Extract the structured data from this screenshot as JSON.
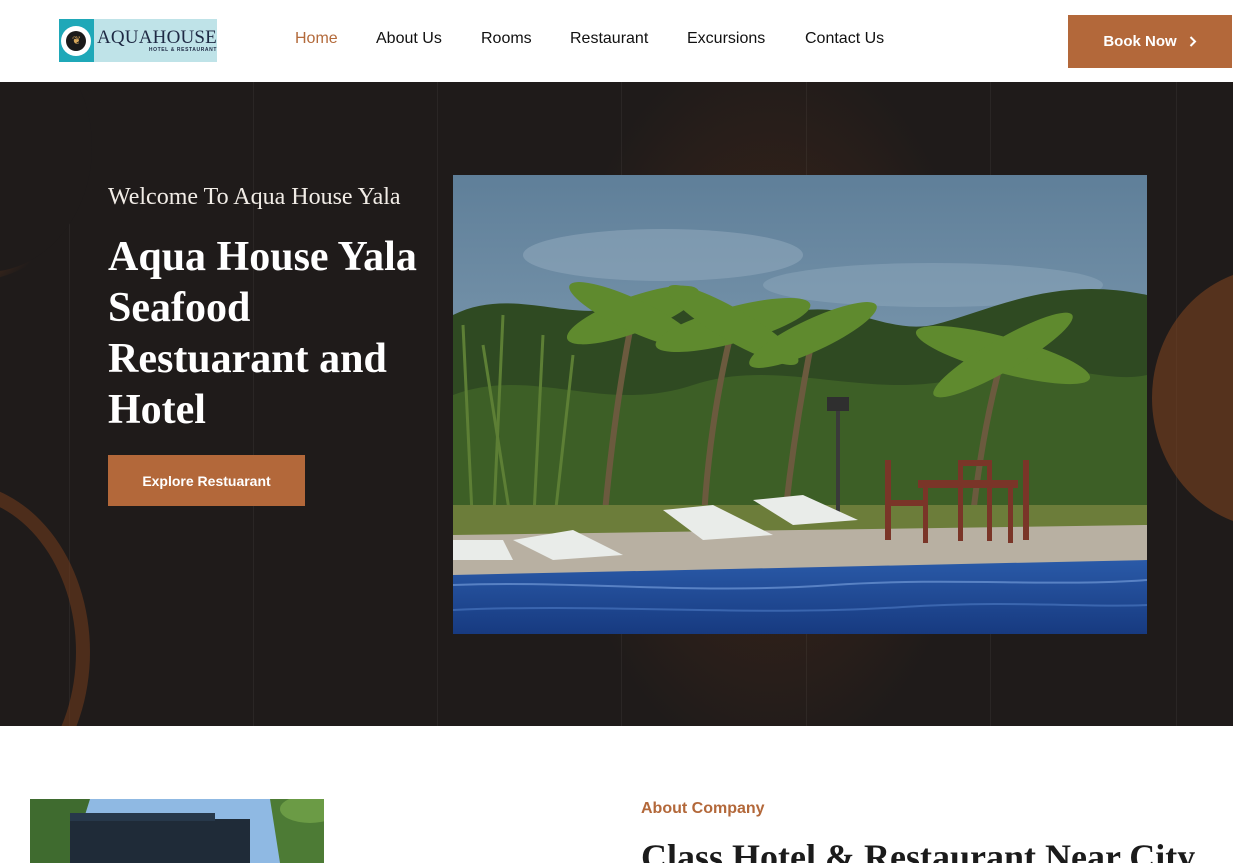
{
  "brand": {
    "logo_main": "AQUAHOUSE",
    "logo_sub": "HOTEL & RESTAURANT",
    "accent": "#b3683a",
    "dark": "#1f1b1a"
  },
  "nav": {
    "items": [
      {
        "label": "Home",
        "active": true
      },
      {
        "label": "About Us",
        "active": false
      },
      {
        "label": "Rooms",
        "active": false
      },
      {
        "label": "Restaurant",
        "active": false
      },
      {
        "label": "Excursions",
        "active": false
      },
      {
        "label": "Contact Us",
        "active": false
      }
    ],
    "cta_label": "Book Now",
    "cta_icon": "chevron-right-icon"
  },
  "hero": {
    "subtitle": "Welcome To Aqua House Yala",
    "title": "Aqua House Yala Seafood Restuarant and Hotel",
    "button_label": "Explore Restuarant",
    "image": "pool-with-palm-trees-photo"
  },
  "about": {
    "kicker": "About Company",
    "title": "Class Hotel & Restaurant Near City",
    "image": "hotel-exterior-photo"
  }
}
